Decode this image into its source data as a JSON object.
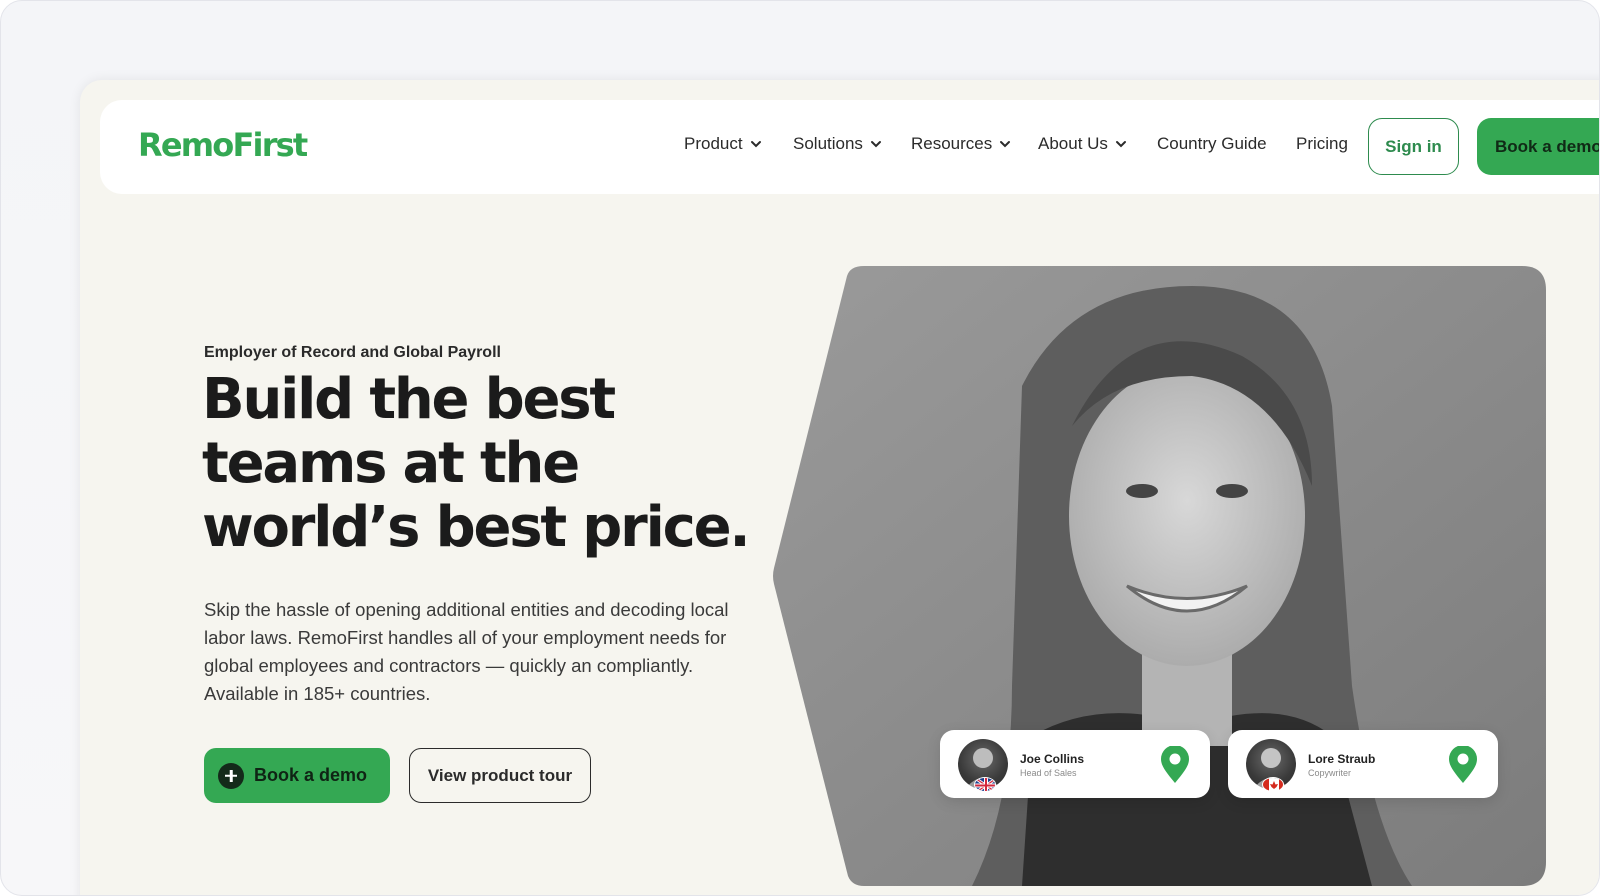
{
  "brand": {
    "logo_text": "RemoFirst",
    "accent": "#34a853",
    "accent_dark": "#2e8b4e"
  },
  "nav": {
    "items": [
      {
        "label": "Product",
        "dropdown": true
      },
      {
        "label": "Solutions",
        "dropdown": true
      },
      {
        "label": "Resources",
        "dropdown": true
      },
      {
        "label": "About Us",
        "dropdown": true
      },
      {
        "label": "Country Guide",
        "dropdown": false
      },
      {
        "label": "Pricing",
        "dropdown": false
      }
    ],
    "sign_in": "Sign in",
    "book_demo": "Book a demo"
  },
  "hero": {
    "eyebrow": "Employer of Record and Global Payroll",
    "headline": "Build the best teams at the world’s best price.",
    "subtext": "Skip the hassle of opening additional entities and decoding local labor laws. RemoFirst handles all of your employment needs for global employees and contractors — quickly an compliantly. Available in 185+ countries.",
    "cta_primary": "Book a demo",
    "cta_primary_icon": "plus-circle-icon",
    "cta_secondary": "View product tour"
  },
  "cards": [
    {
      "name": "Joe Collins",
      "role": "Head of Sales",
      "flag": "uk-flag-icon",
      "pin": "location-pin-icon"
    },
    {
      "name": "Lore Straub",
      "role": "Copywriter",
      "flag": "canada-flag-icon",
      "pin": "location-pin-icon"
    }
  ]
}
